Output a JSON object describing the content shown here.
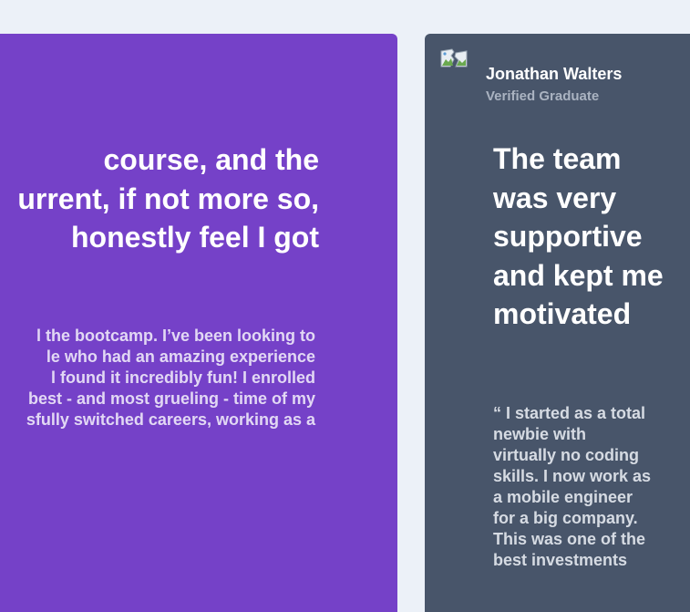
{
  "testimonials": [
    {
      "heading_lines": [
        "course, and the",
        "urrent, if not more so,",
        "honestly feel I got"
      ],
      "body_lines": [
        "l the bootcamp. I’ve been looking to",
        "le who had an amazing experience",
        "l found it incredibly fun! I enrolled",
        "best - and most grueling - time of my",
        "sfully switched careers, working as a"
      ],
      "background_color": "#7541c8"
    },
    {
      "author_name": "Jonathan Walters",
      "author_role": "Verified Graduate",
      "avatar_icon": "broken-image-icon",
      "heading": "The team was very supportive and kept me motivated",
      "body": "“ I started as a total newbie with virtually no coding skills. I now work as a mobile engineer for a big company. This was one of the best investments",
      "background_color": "#48556a"
    }
  ]
}
